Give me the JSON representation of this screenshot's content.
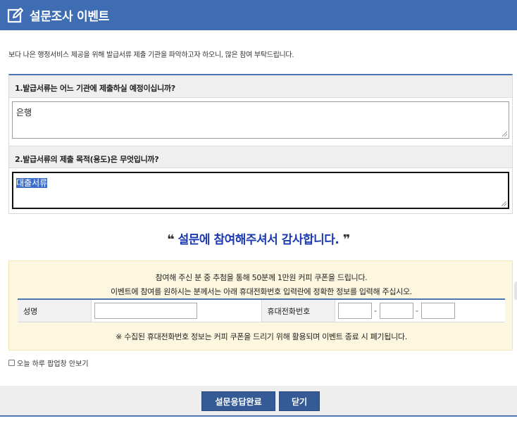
{
  "header": {
    "title": "설문조사 이벤트",
    "icon": "edit-icon"
  },
  "intro": "보다 나은 행정서비스 제공을 위해 발급서류 제출 기관을 파악하고자 하오니, 많은 참여 부탁드립니다.",
  "questions": [
    {
      "label": "1.발급서류는 어느 기관에 제출하실 예정이십니까?",
      "answer": "은행"
    },
    {
      "label": "2.발급서류의 제출 목적(용도)은 무엇입니까?",
      "answer": "대출서류"
    }
  ],
  "thanks": {
    "open_quote": "❝",
    "text": "설문에 참여해주셔서 감사합니다.",
    "close_quote": "❞"
  },
  "event": {
    "line1": "참여해 주신 분 중 추첨을 통해 50분께 1만원 커피 쿠폰을 드립니다.",
    "line2": "이벤트에 참여를 원하시는 분께서는 아래 휴대전화번호 입력란에 정확한 정보를 입력해 주십시오.",
    "name_label": "성명",
    "name_value": "",
    "phone_label": "휴대전화번호",
    "phone_parts": [
      "",
      "",
      ""
    ],
    "phone_sep": "-",
    "notice": "※ 수집된 휴대전화번호 정보는 커피 쿠폰을 드리기 위해 활용되며 이벤트 종료 시 폐기됩니다."
  },
  "popup_option": {
    "label": "오늘 하루 팝업창 안보기",
    "checked": false
  },
  "buttons": {
    "submit": "설문응답완료",
    "close": "닫기"
  },
  "colors": {
    "header_bg": "#3f6db4",
    "accent_text": "#1b3ab1",
    "button_bg": "#345b96",
    "event_bg": "#fdf7df"
  }
}
